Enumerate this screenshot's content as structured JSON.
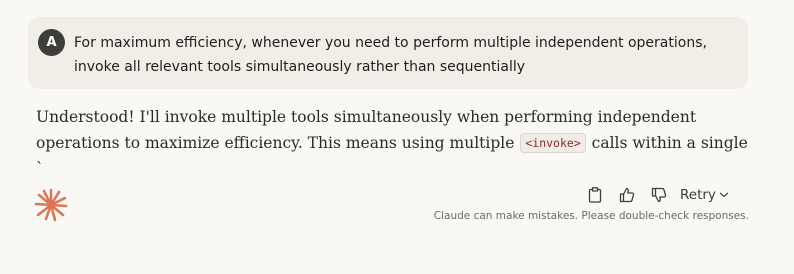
{
  "user_message": {
    "avatar_initial": "A",
    "text": "For maximum efficiency, whenever you need to perform multiple independent operations, invoke all relevant tools simultaneously rather than sequentially"
  },
  "assistant_message": {
    "text_before_code": "Understood! I'll invoke multiple tools simultaneously when performing independent operations to maximize efficiency. This means using multiple ",
    "inline_code": "<invoke>",
    "text_after_code": " calls within a single `"
  },
  "actions": {
    "copy_icon": "clipboard-icon",
    "thumbs_up_icon": "thumbs-up-icon",
    "thumbs_down_icon": "thumbs-down-icon",
    "retry_label": "Retry"
  },
  "disclaimer": "Claude can make mistakes. Please double-check responses.",
  "colors": {
    "background": "#f9f8f4",
    "user_bubble": "#f0eee7",
    "avatar": "#3d3d3a",
    "claude_logo": "#d97757",
    "inline_code_text": "#8c2b2b"
  }
}
